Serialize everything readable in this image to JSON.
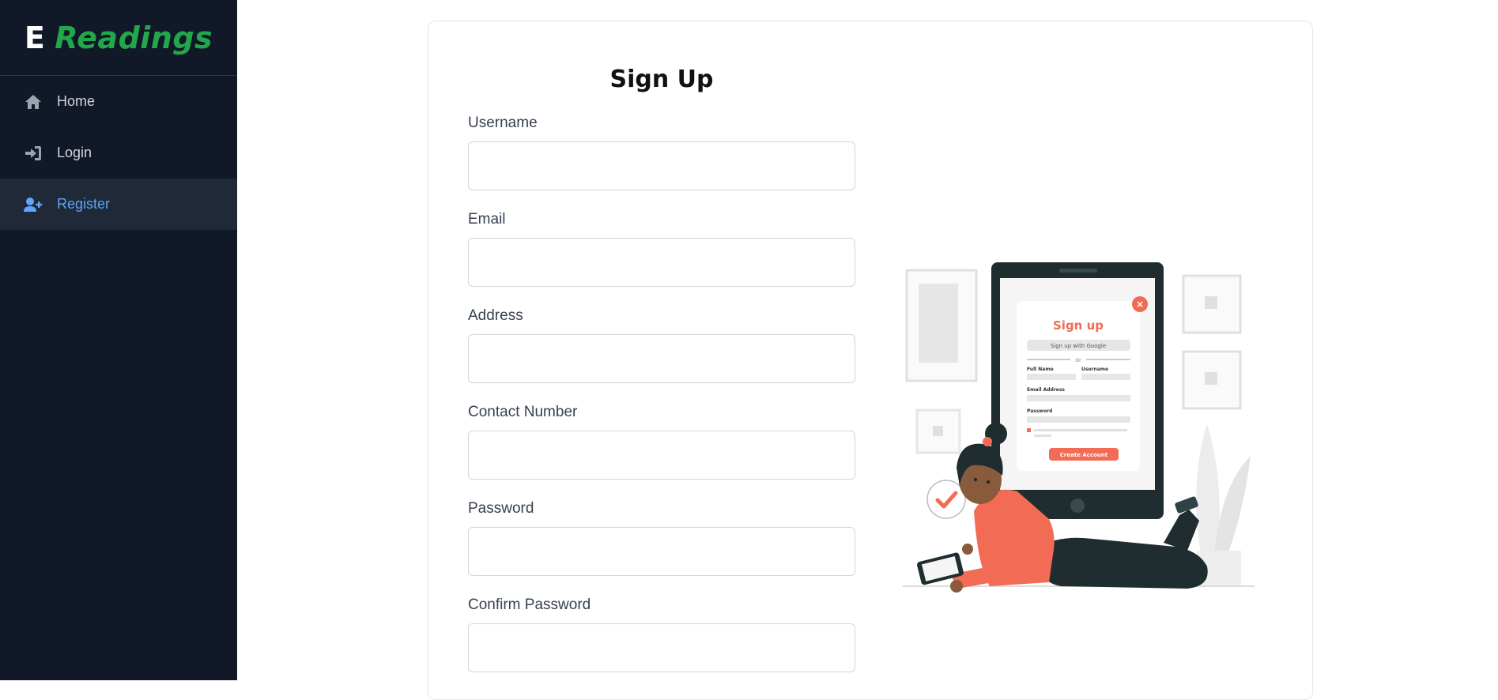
{
  "brand": {
    "prefix": "E",
    "name": "Readings"
  },
  "sidebar": {
    "items": [
      {
        "label": "Home",
        "icon": "home-icon",
        "active": false
      },
      {
        "label": "Login",
        "icon": "login-icon",
        "active": false
      },
      {
        "label": "Register",
        "icon": "user-plus-icon",
        "active": true
      }
    ]
  },
  "form": {
    "title": "Sign Up",
    "fields": [
      {
        "label": "Username",
        "value": "",
        "placeholder": ""
      },
      {
        "label": "Email",
        "value": "",
        "placeholder": ""
      },
      {
        "label": "Address",
        "value": "",
        "placeholder": ""
      },
      {
        "label": "Contact Number",
        "value": "",
        "placeholder": ""
      },
      {
        "label": "Password",
        "value": "",
        "placeholder": ""
      },
      {
        "label": "Confirm Password",
        "value": "",
        "placeholder": ""
      }
    ]
  },
  "illustration": {
    "title": "Sign up",
    "google_button": "Sign up with Google",
    "divider": "Or",
    "labels": [
      "Full Name",
      "Username",
      "Email Address",
      "Password"
    ],
    "submit": "Create Account"
  },
  "colors": {
    "sidebar_bg": "#111827",
    "accent": "#60a5fa",
    "brand_green": "#22a84a",
    "illustration_accent": "#f26b55"
  }
}
